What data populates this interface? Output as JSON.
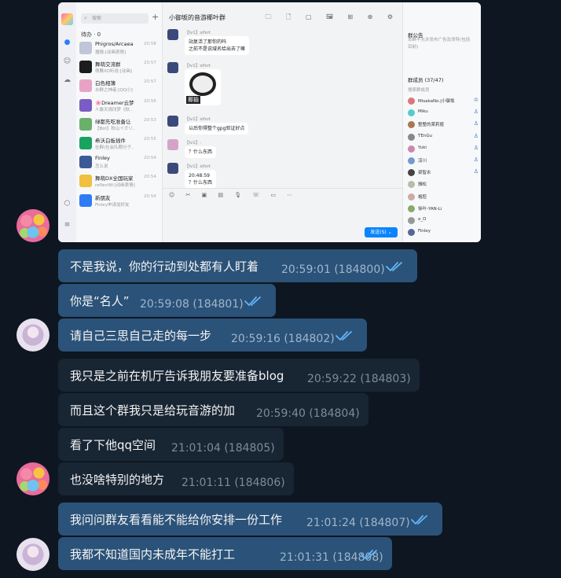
{
  "qq": {
    "search_placeholder": "搜索",
    "plus": "+",
    "todo": "待办 · 0",
    "chats": [
      {
        "name": "Phigros/Arcaea",
        "preview": "播报:[动画表情]",
        "time": "20:58",
        "color": "#bfc6d6"
      },
      {
        "name": "舞萌交流群",
        "preview": "萌舞XD听说:[动画]",
        "time": "20:57",
        "color": "#1c1c1c"
      },
      {
        "name": "白色相簿",
        "preview": "水群之神者:[QQ小]",
        "time": "20:57",
        "color": "#e8a3c4"
      },
      {
        "name": "🌸Dreamer云梦",
        "preview": "人像天境冈梦《秋..",
        "time": "20:56",
        "color": "#7a5cc4"
      },
      {
        "name": "绿都先吃准备让",
        "preview": "【Bot】秋山イガリ..",
        "time": "20:53",
        "color": "#6ab06a"
      },
      {
        "name": "希沃白板插件",
        "preview": "社群(社会队期分子..",
        "time": "20:55",
        "color": "#1aa260"
      },
      {
        "name": "Finley",
        "preview": "怎么说",
        "time": "20:54",
        "color": "#3c5a96"
      },
      {
        "name": "舞萌DX全国玩家",
        "preview": "reflectW:[动画表情]",
        "time": "20:54",
        "color": "#f0c040"
      },
      {
        "name": "新朋友",
        "preview": "Finley申请加好友",
        "time": "20:54",
        "color": "#2d7cf6"
      }
    ],
    "title": "小御坂的音游椰叶群",
    "tools": "🗀 🗋 ▢ 🖼 ⊞ ⊕ ⚙",
    "messages": [
      {
        "name": "【lv1】sifsrt",
        "lines": [
          "站复活了那你的吗",
          "之前不是说域名给出去了嘛"
        ]
      },
      {
        "name": "【lv1】sifsrt",
        "sticker_text": "揶揄"
      },
      {
        "name": "【lv1】sifsrt",
        "lines": [
          "以后你得整个gpg验证好点"
        ]
      },
      {
        "name": "【lv1】-",
        "lines": [
          "？什么东西"
        ]
      },
      {
        "name": "【lv1】sifsrt",
        "lines": [
          "20:48:59",
          "？什么东西"
        ]
      }
    ],
    "input_tools": "☺ ✂ ▣ ▤ 🎙 ☏ ▭ ⋯",
    "send": "发送(S)  ⌄",
    "side": {
      "announcement_title": "群公告",
      "announcement": "本群不允许发布广告及领导(包括目前)",
      "members_title": "群成员 (37/47)",
      "member_search": "搜索群成员",
      "members": [
        {
          "name": "MisakaNo.|小御坂",
          "color": "#d77"
        },
        {
          "name": "Miku",
          "color": "#5cc"
        },
        {
          "name": "整整的莱莉娅",
          "color": "#a75"
        },
        {
          "name": "TEnGu",
          "color": "#888"
        },
        {
          "name": "Yuki",
          "color": "#c8a"
        },
        {
          "name": "凉川",
          "color": "#79c"
        },
        {
          "name": "梁智永",
          "color": "#444"
        },
        {
          "name": "雅松",
          "color": "#bba"
        },
        {
          "name": "格腔",
          "color": "#caa"
        },
        {
          "name": "徐叶-YAN-Li",
          "color": "#8a6"
        },
        {
          "name": "o_O",
          "color": "#999"
        },
        {
          "name": "Finley",
          "color": "#569"
        }
      ]
    }
  },
  "messages": [
    {
      "type": "out",
      "text": "不是我说，你的行动到处都有人盯着",
      "time": "20:59:01 (184800)"
    },
    {
      "type": "out",
      "text": "你是“名人”",
      "time": "20:59:08 (184801)"
    },
    {
      "type": "out",
      "text": "请自己三思自己走的每一步",
      "time": "20:59:16 (184802)"
    },
    {
      "type": "in",
      "text": "我只是之前在机厅告诉我朋友要准备blog",
      "time": "20:59:22 (184803)"
    },
    {
      "type": "in",
      "text": "而且这个群我只是给玩音游的加",
      "time": "20:59:40 (184804)"
    },
    {
      "type": "in",
      "text": "看了下他qq空间",
      "time": "21:01:04 (184805)"
    },
    {
      "type": "in",
      "text": "也没啥特别的地方",
      "time": "21:01:11 (184806)"
    },
    {
      "type": "out",
      "text": "我问问群友看看能不能给你安排一份工作",
      "time": "21:01:24 (184807)"
    },
    {
      "type": "out",
      "text": "我都不知道国内未成年不能打工",
      "time": "21:01:31 (184808)"
    }
  ],
  "colors": {
    "bg": "#0e1621",
    "out_bubble": "#2b5278",
    "in_bubble": "#182533",
    "check": "#64b5f6"
  }
}
